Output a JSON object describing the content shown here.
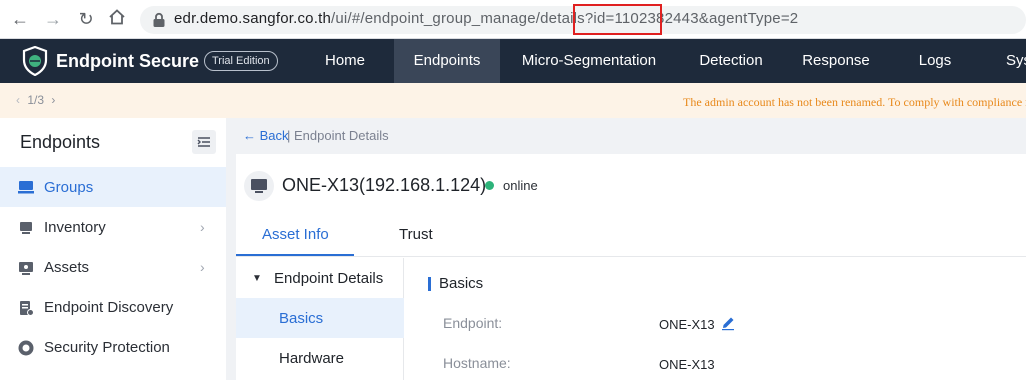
{
  "browser": {
    "back_icon": "arrow-left-icon",
    "forward_icon": "arrow-right-icon",
    "reload_icon": "reload-icon",
    "home_icon": "home-icon",
    "url_host": "edr.demo.sangfor.co.th",
    "url_path_before": "/ui/#/endpoint_group_manage/details?id",
    "url_highlighted": "=1102382443",
    "url_path_after": "&agentType=2",
    "highlight_color": "#e02020"
  },
  "app": {
    "brand": "Endpoint Secure",
    "edition": "Trial Edition",
    "header_color": "#1e2a3b",
    "accent_color": "#2a6ed4",
    "top_nav": [
      {
        "label": "Home",
        "active": false
      },
      {
        "label": "Endpoints",
        "active": true
      },
      {
        "label": "Micro-Segmentation",
        "active": false
      },
      {
        "label": "Detection",
        "active": false
      },
      {
        "label": "Response",
        "active": false
      },
      {
        "label": "Logs",
        "active": false
      },
      {
        "label": "Sys",
        "active": false
      }
    ]
  },
  "notice": {
    "pager": "1/3",
    "text": "The admin account has not been renamed. To comply with compliance r"
  },
  "sidebar": {
    "title": "Endpoints",
    "items": [
      {
        "label": "Groups",
        "icon": "groups-icon",
        "active": true,
        "has_children": false
      },
      {
        "label": "Inventory",
        "icon": "inventory-icon",
        "active": false,
        "has_children": true
      },
      {
        "label": "Assets",
        "icon": "assets-icon",
        "active": false,
        "has_children": true
      },
      {
        "label": "Endpoint Discovery",
        "icon": "discovery-icon",
        "active": false,
        "has_children": false
      },
      {
        "label": "Security Protection",
        "icon": "security-icon",
        "active": false,
        "has_children": false
      }
    ]
  },
  "main": {
    "back_label": "Back",
    "breadcrumb_current": "| Endpoint Details",
    "endpoint_title": "ONE-X13(192.168.1.124)",
    "status": "online",
    "status_color": "#2db37a",
    "tabs": [
      {
        "label": "Asset Info",
        "active": true
      },
      {
        "label": "Trust",
        "active": false
      }
    ],
    "sub_nav": {
      "group_label": "Endpoint Details",
      "items": [
        {
          "label": "Basics",
          "active": true
        },
        {
          "label": "Hardware",
          "active": false
        }
      ]
    },
    "section_title": "Basics",
    "fields": [
      {
        "label": "Endpoint:",
        "value": "ONE-X13",
        "editable": true
      },
      {
        "label": "Hostname:",
        "value": "ONE-X13",
        "editable": false
      }
    ]
  }
}
